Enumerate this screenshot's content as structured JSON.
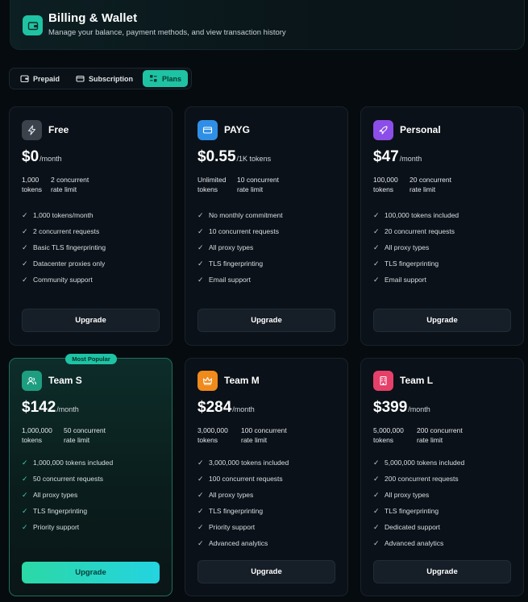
{
  "header": {
    "title": "Billing & Wallet",
    "subtitle": "Manage your balance, payment methods, and view transaction history",
    "icon": "wallet-icon"
  },
  "tabs": [
    {
      "label": "Prepaid",
      "icon": "wallet-icon",
      "active": false
    },
    {
      "label": "Subscription",
      "icon": "card-icon",
      "active": false
    },
    {
      "label": "Plans",
      "icon": "plans-icon",
      "active": true
    }
  ],
  "colors": {
    "accent": "#1ec3a4",
    "free": "#3b424b",
    "payg": "#2f8fe6",
    "personal": "#8c4ee8",
    "team_s": "#1e9e80",
    "team_m": "#f08a1c",
    "team_l": "#e6406a"
  },
  "plans": [
    {
      "name": "Free",
      "icon": "bolt-icon",
      "price": "$0",
      "per": "/month",
      "stat1": [
        "1,000",
        "tokens"
      ],
      "stat2": [
        "2 concurrent",
        "rate limit"
      ],
      "features": [
        "1,000 tokens/month",
        "2 concurrent requests",
        "Basic TLS fingerprinting",
        "Datacenter proxies only",
        "Community support"
      ],
      "button": "Upgrade"
    },
    {
      "name": "PAYG",
      "icon": "credit-card-icon",
      "price": "$0.55",
      "per": "/1K tokens",
      "stat1": [
        "Unlimited",
        "tokens"
      ],
      "stat2": [
        "10 concurrent",
        "rate limit"
      ],
      "features": [
        "No monthly commitment",
        "10 concurrent requests",
        "All proxy types",
        "TLS fingerprinting",
        "Email support"
      ],
      "button": "Upgrade"
    },
    {
      "name": "Personal",
      "icon": "rocket-icon",
      "price": "$47",
      "per": "/month",
      "stat1": [
        "100,000",
        "tokens"
      ],
      "stat2": [
        "20 concurrent",
        "rate limit"
      ],
      "features": [
        "100,000 tokens included",
        "20 concurrent requests",
        "All proxy types",
        "TLS fingerprinting",
        "Email support"
      ],
      "button": "Upgrade"
    },
    {
      "name": "Team S",
      "icon": "users-icon",
      "price": "$142",
      "per": "/month",
      "badge": "Most Popular",
      "stat1": [
        "1,000,000",
        "tokens"
      ],
      "stat2": [
        "50 concurrent",
        "rate limit"
      ],
      "features": [
        "1,000,000 tokens included",
        "50 concurrent requests",
        "All proxy types",
        "TLS fingerprinting",
        "Priority support"
      ],
      "button": "Upgrade"
    },
    {
      "name": "Team M",
      "icon": "crown-icon",
      "price": "$284",
      "per": "/month",
      "stat1": [
        "3,000,000",
        "tokens"
      ],
      "stat2": [
        "100 concurrent",
        "rate limit"
      ],
      "features": [
        "3,000,000 tokens included",
        "100 concurrent requests",
        "All proxy types",
        "TLS fingerprinting",
        "Priority support",
        "Advanced analytics"
      ],
      "button": "Upgrade"
    },
    {
      "name": "Team L",
      "icon": "building-icon",
      "price": "$399",
      "per": "/month",
      "stat1": [
        "5,000,000",
        "tokens"
      ],
      "stat2": [
        "200 concurrent",
        "rate limit"
      ],
      "features": [
        "5,000,000 tokens included",
        "200 concurrent requests",
        "All proxy types",
        "TLS fingerprinting",
        "Dedicated support",
        "Advanced analytics"
      ],
      "button": "Upgrade"
    }
  ]
}
